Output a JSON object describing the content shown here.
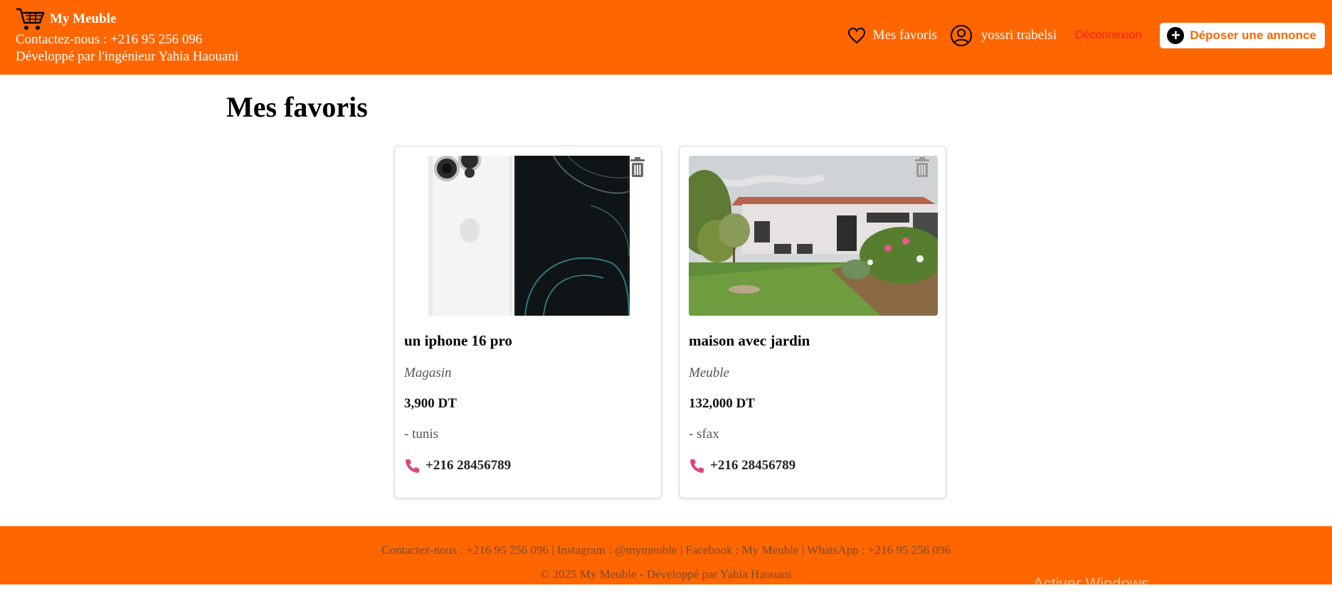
{
  "colors": {
    "brand": "#ff6600",
    "logout": "#ff1a1a",
    "phone_icon": "#e0457a"
  },
  "header": {
    "brand_name": "My Meuble",
    "contact_line": "Contactez-nous : +216 95 256 096",
    "dev_line": "Développé par l'ingénieur Yahia Haouani",
    "nav": {
      "favorites_label": "Mes favoris",
      "user_name": "yossri trabelsi",
      "logout_label": "Déconnexion",
      "post_ad_label": "Déposer une annonce"
    },
    "icons": [
      "cart-icon",
      "heart-icon",
      "user-circle-icon",
      "plus-circle-icon"
    ]
  },
  "main": {
    "title": "Mes favoris",
    "cards": [
      {
        "title": "un iphone 16 pro",
        "category": "Magasin",
        "price": "3,900 DT",
        "location": "- tunis",
        "phone": "+216 28456789",
        "image": "iphone-photo"
      },
      {
        "title": "maison avec jardin",
        "category": "Meuble",
        "price": "132,000 DT",
        "location": "- sfax",
        "phone": "+216 28456789",
        "image": "house-garden-photo"
      }
    ]
  },
  "footer": {
    "line1": "Contactez-nous : +216 95 256 096 | Instagram : @mymeuble | Facebook : My Meuble | WhatsApp : +216 95 256 096",
    "line2": "© 2025 My Meuble - Développé par Yahia Haouani"
  },
  "overlay": {
    "activate_windows": "Activer Windows"
  }
}
